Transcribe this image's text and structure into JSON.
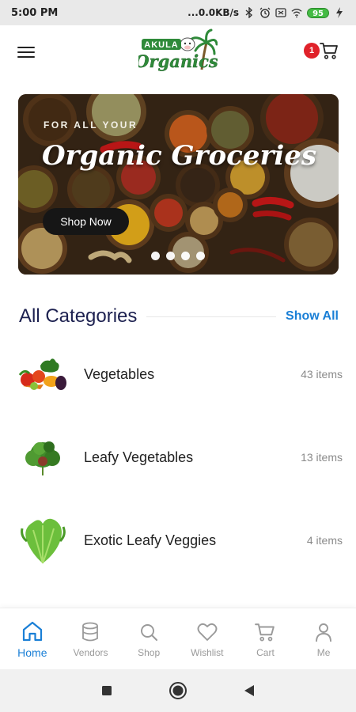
{
  "status_bar": {
    "time": "5:00 PM",
    "network_speed": "...0.0KB/s",
    "battery": "95",
    "icons": [
      "bluetooth-icon",
      "alarm-icon",
      "sim-icon",
      "wifi-icon",
      "battery-icon",
      "charging-icon"
    ]
  },
  "header": {
    "logo_line1": "AKULA",
    "logo_line2": "Organics",
    "cart_badge": "1",
    "icons": [
      "menu-icon",
      "cart-icon"
    ]
  },
  "banner": {
    "eyebrow": "FOR ALL YOUR",
    "title": "Organic Groceries",
    "button_label": "Shop Now",
    "slide_count": 4
  },
  "categories": {
    "title": "All Categories",
    "show_all_label": "Show All",
    "items": [
      {
        "name": "Vegetables",
        "count": "43 items"
      },
      {
        "name": "Leafy Vegetables",
        "count": "13 items"
      },
      {
        "name": "Exotic Leafy Veggies",
        "count": "4 items"
      }
    ]
  },
  "bottom_nav": {
    "items": [
      {
        "label": "Home",
        "icon": "home-icon",
        "active": true
      },
      {
        "label": "Vendors",
        "icon": "database-icon",
        "active": false
      },
      {
        "label": "Shop",
        "icon": "search-icon",
        "active": false
      },
      {
        "label": "Wishlist",
        "icon": "heart-icon",
        "active": false
      },
      {
        "label": "Cart",
        "icon": "cart-icon",
        "active": false
      },
      {
        "label": "Me",
        "icon": "user-icon",
        "active": false
      }
    ]
  },
  "system_nav": {
    "icons": [
      "recents-square-icon",
      "home-circle-icon",
      "back-triangle-icon"
    ]
  },
  "colors": {
    "accent": "#1a7fd6",
    "heading": "#1d2150",
    "badge": "#e0222a",
    "logo_green": "#2f8a3a",
    "text": "#222222",
    "muted": "#8a8a8a"
  }
}
